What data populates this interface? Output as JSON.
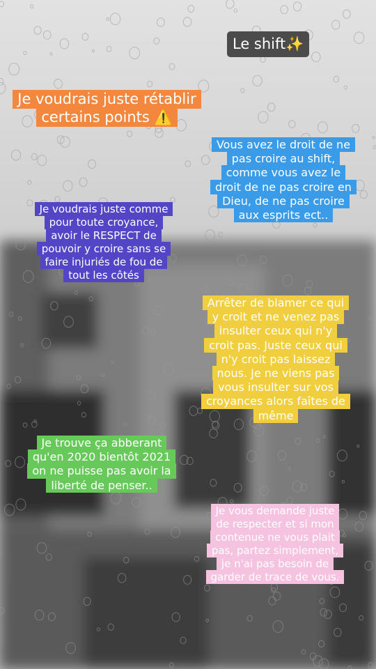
{
  "header": {
    "title": "Le shift",
    "sparkle": "✨"
  },
  "captions": {
    "orange": {
      "lines": [
        "Je voudrais juste rétablir",
        "certains points ⚠️"
      ],
      "bg": "#f2873d",
      "color": "#ffffff"
    },
    "blue": {
      "lines": [
        "Vous avez le droit de ne",
        "pas croire au shift,",
        "comme vous avez le",
        "droit de ne pas croire en",
        "Dieu, de ne pas croire",
        "aux esprits ect.."
      ],
      "bg": "#3a9be9",
      "color": "#ffffff"
    },
    "purple": {
      "lines": [
        "Je voudrais juste comme",
        "pour toute croyance,",
        "avoir le RESPECT de",
        "pouvoir y croire sans se",
        "faire injuriés de fou de",
        "tout les côtés"
      ],
      "bg": "#5246c7",
      "color": "#ffffff"
    },
    "yellow": {
      "lines": [
        "Arrêter de blamer ce qui",
        "y croit et ne venez pas",
        "insulter ceux qui n'y",
        "croit pas. Juste ceux qui",
        "n'y croit pas laissez",
        "nous. Je ne viens pas",
        "vous insulter sur vos",
        "croyances alors faîtes de",
        "même"
      ],
      "bg": "#f1ce3e",
      "color": "#ffffff"
    },
    "green": {
      "lines": [
        "Je trouve ça abberant",
        "qu'en 2020 bientôt 2021",
        "on ne puisse pas avoir la",
        "liberté de penser.."
      ],
      "bg": "#67c95a",
      "color": "#ffffff"
    },
    "pink": {
      "lines": [
        "Je vous demande juste",
        "de respecter et si mon",
        "contenue ne vous plait",
        "pas, partez simplement,",
        "je n'ai pas besoin de",
        "garder de trace de vous."
      ],
      "bg": "#f5c3e0",
      "color": "#ffffff"
    }
  }
}
